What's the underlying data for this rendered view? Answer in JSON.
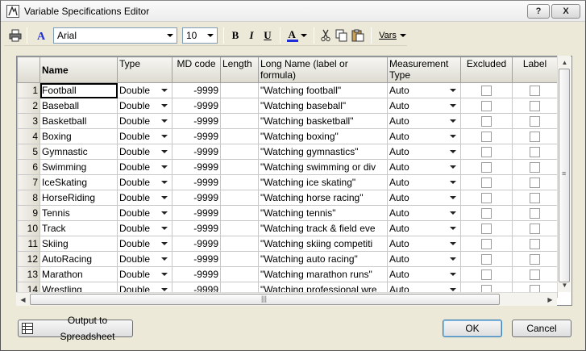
{
  "window": {
    "title": "Variable Specifications Editor"
  },
  "titlebar": {
    "help_label": "?",
    "close_label": "X"
  },
  "toolbar": {
    "font_name": "Arial",
    "font_size": "10",
    "bold_label": "B",
    "italic_label": "I",
    "underline_label": "U",
    "font_color_label": "A",
    "vars_label": "Vars"
  },
  "grid": {
    "headers": [
      "Name",
      "Type",
      "MD code",
      "Length",
      "Long Name (label or formula)",
      "Measurement Type",
      "Excluded",
      "Label"
    ],
    "rows": [
      {
        "num": "1",
        "name": "Football",
        "type": "Double",
        "md": "-9999",
        "length": "",
        "long": "\"Watching football\"",
        "meas": "Auto"
      },
      {
        "num": "2",
        "name": "Baseball",
        "type": "Double",
        "md": "-9999",
        "length": "",
        "long": "\"Watching baseball\"",
        "meas": "Auto"
      },
      {
        "num": "3",
        "name": "Basketball",
        "type": "Double",
        "md": "-9999",
        "length": "",
        "long": "\"Watching basketball\"",
        "meas": "Auto"
      },
      {
        "num": "4",
        "name": "Boxing",
        "type": "Double",
        "md": "-9999",
        "length": "",
        "long": "\"Watching boxing\"",
        "meas": "Auto"
      },
      {
        "num": "5",
        "name": "Gymnastic",
        "type": "Double",
        "md": "-9999",
        "length": "",
        "long": "\"Watching gymnastics\"",
        "meas": "Auto"
      },
      {
        "num": "6",
        "name": "Swimming",
        "type": "Double",
        "md": "-9999",
        "length": "",
        "long": "\"Watching swimming or div",
        "meas": "Auto"
      },
      {
        "num": "7",
        "name": "IceSkating",
        "type": "Double",
        "md": "-9999",
        "length": "",
        "long": "\"Watching ice skating\"",
        "meas": "Auto"
      },
      {
        "num": "8",
        "name": "HorseRiding",
        "type": "Double",
        "md": "-9999",
        "length": "",
        "long": "\"Watching horse racing\"",
        "meas": "Auto"
      },
      {
        "num": "9",
        "name": "Tennis",
        "type": "Double",
        "md": "-9999",
        "length": "",
        "long": "\"Watching tennis\"",
        "meas": "Auto"
      },
      {
        "num": "10",
        "name": "Track",
        "type": "Double",
        "md": "-9999",
        "length": "",
        "long": "\"Watching track & field eve",
        "meas": "Auto"
      },
      {
        "num": "11",
        "name": "Skiing",
        "type": "Double",
        "md": "-9999",
        "length": "",
        "long": "\"Watching skiing competiti",
        "meas": "Auto"
      },
      {
        "num": "12",
        "name": "AutoRacing",
        "type": "Double",
        "md": "-9999",
        "length": "",
        "long": "\"Watching auto racing\"",
        "meas": "Auto"
      },
      {
        "num": "13",
        "name": "Marathon",
        "type": "Double",
        "md": "-9999",
        "length": "",
        "long": "\"Watching marathon runs\"",
        "meas": "Auto"
      },
      {
        "num": "14",
        "name": "Wrestling",
        "type": "Double",
        "md": "-9999",
        "length": "",
        "long": "\"Watching professional wre",
        "meas": "Auto"
      }
    ]
  },
  "footer": {
    "output_label": "Output to Spreadsheet",
    "ok_label": "OK",
    "cancel_label": "Cancel"
  },
  "colors": {
    "font_color_bar": "#1f2ddb",
    "grid_border": "#828790"
  }
}
